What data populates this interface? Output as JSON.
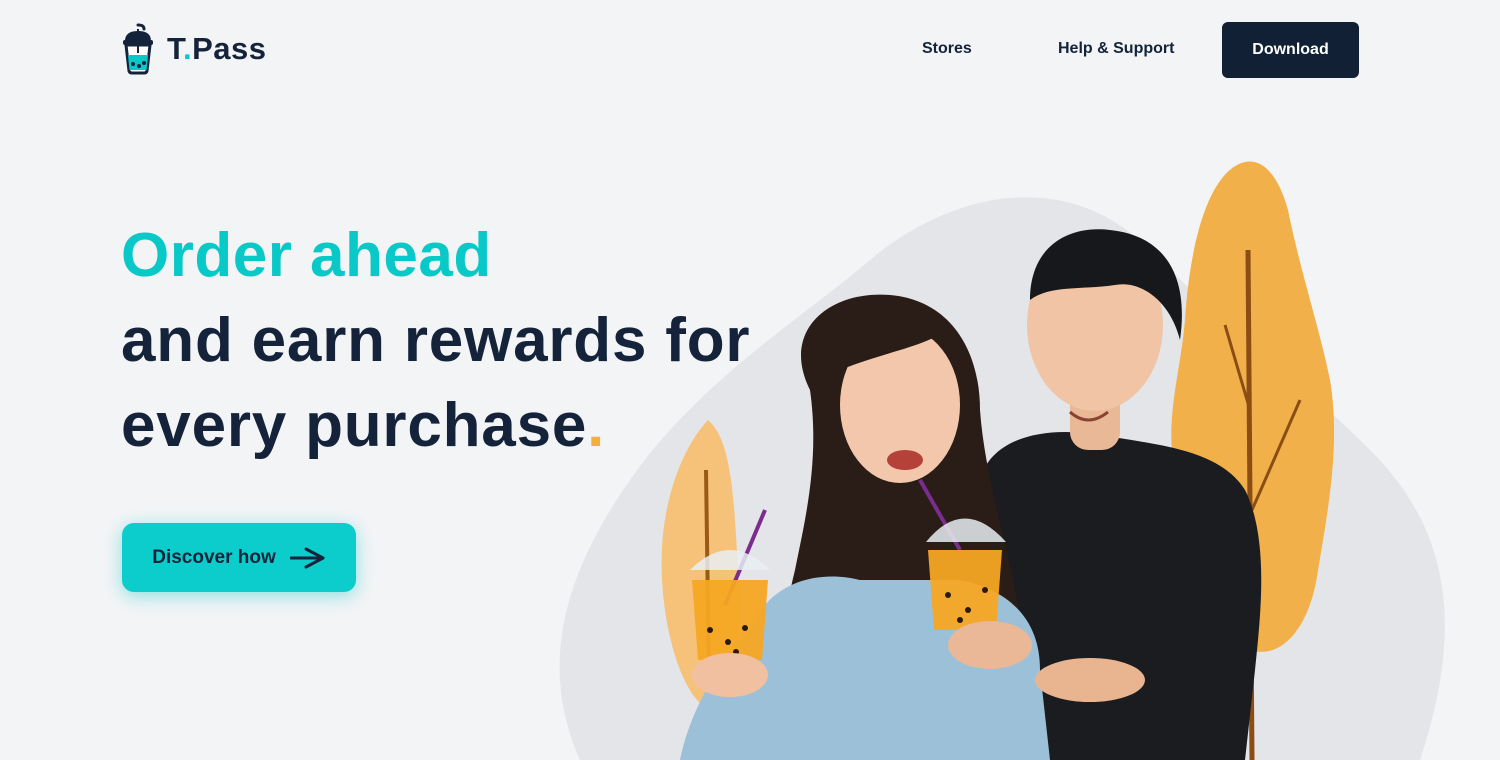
{
  "brand": {
    "name_main": "T",
    "name_dot": ".",
    "name_rest": "Pass"
  },
  "nav": {
    "stores_label": "Stores",
    "help_label": "Help & Support",
    "download_label": "Download"
  },
  "hero": {
    "headline_line1": "Order ahead",
    "headline_line2": "and earn rewards for",
    "headline_line3": "every purchase",
    "headline_dot": ".",
    "cta_label": "Discover how"
  },
  "icons": {
    "logo": "bubble-tea-cup-icon",
    "cta": "arrow-right-icon"
  },
  "colors": {
    "accent_teal": "#09c8c8",
    "accent_orange": "#f3ad48",
    "navy": "#112034",
    "background": "#f3f4f6"
  }
}
